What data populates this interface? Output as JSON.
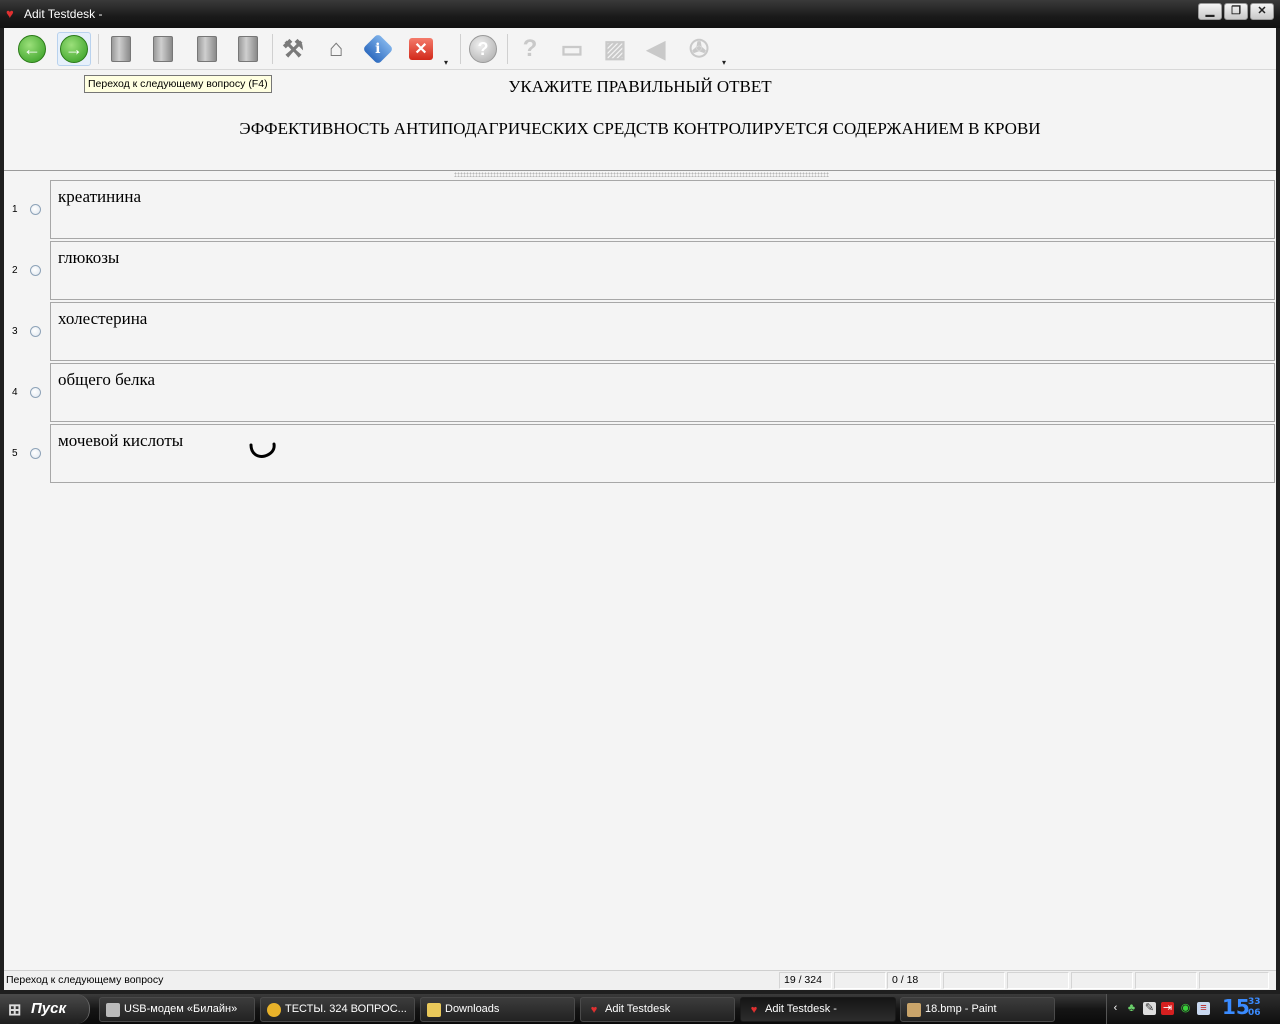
{
  "window": {
    "title": "Adit Testdesk -",
    "minimize": "▁",
    "maximize": "❐",
    "close": "✕"
  },
  "toolbar": {
    "buttons": [
      {
        "name": "back-icon",
        "glyph": "←"
      },
      {
        "name": "forward-icon",
        "glyph": "→"
      },
      {
        "name": "prev-book-icon",
        "glyph": ""
      },
      {
        "name": "next-book-icon",
        "glyph": ""
      },
      {
        "name": "add-book-icon",
        "glyph": ""
      },
      {
        "name": "book-icon",
        "glyph": ""
      },
      {
        "name": "tools-icon",
        "glyph": "⚒"
      },
      {
        "name": "home-icon",
        "glyph": "⌂"
      },
      {
        "name": "info-icon",
        "glyph": "i"
      },
      {
        "name": "close-test-icon",
        "glyph": "✕"
      },
      {
        "name": "help-icon",
        "glyph": "?"
      },
      {
        "name": "hint-icon",
        "glyph": "?"
      },
      {
        "name": "presentation-icon",
        "glyph": "▭"
      },
      {
        "name": "image-icon",
        "glyph": "▨"
      },
      {
        "name": "sound-icon",
        "glyph": "◀"
      },
      {
        "name": "video-icon",
        "glyph": "✇"
      }
    ],
    "tooltip": "Переход к следующему вопросу (F4)"
  },
  "question": {
    "header": "УКАЖИТЕ ПРАВИЛЬНЫЙ ОТВЕТ",
    "text": "ЭФФЕКТИВНОСТЬ АНТИПОДАГРИЧЕСКИХ СРЕДСТВ КОНТРОЛИРУЕТСЯ СОДЕРЖАНИЕМ В КРОВИ"
  },
  "answers": [
    {
      "num": "1",
      "label": "креатинина"
    },
    {
      "num": "2",
      "label": "глюкозы"
    },
    {
      "num": "3",
      "label": "холестерина"
    },
    {
      "num": "4",
      "label": "общего белка"
    },
    {
      "num": "5",
      "label": "мочевой кислоты"
    }
  ],
  "status": {
    "message": "Переход к следующему вопросу",
    "progress": "19 / 324",
    "score": "0 / 18"
  },
  "taskbar": {
    "start": "Пуск",
    "tasks": [
      {
        "label": "USB-модем «Билайн»",
        "icon_color": "#bbbbbb"
      },
      {
        "label": "ТЕСТЫ. 324 ВОПРОС...",
        "icon_color": "#e8b22a"
      },
      {
        "label": "Downloads",
        "icon_color": "#e9c85a"
      },
      {
        "label": "Adit Testdesk",
        "icon_color": "#e03030"
      },
      {
        "label": "Adit Testdesk -",
        "icon_color": "#e03030"
      },
      {
        "label": "18.bmp - Paint",
        "icon_color": "#c9a46a"
      }
    ],
    "clock_hours": "15",
    "clock_minutes": "33",
    "clock_seconds": "06"
  }
}
